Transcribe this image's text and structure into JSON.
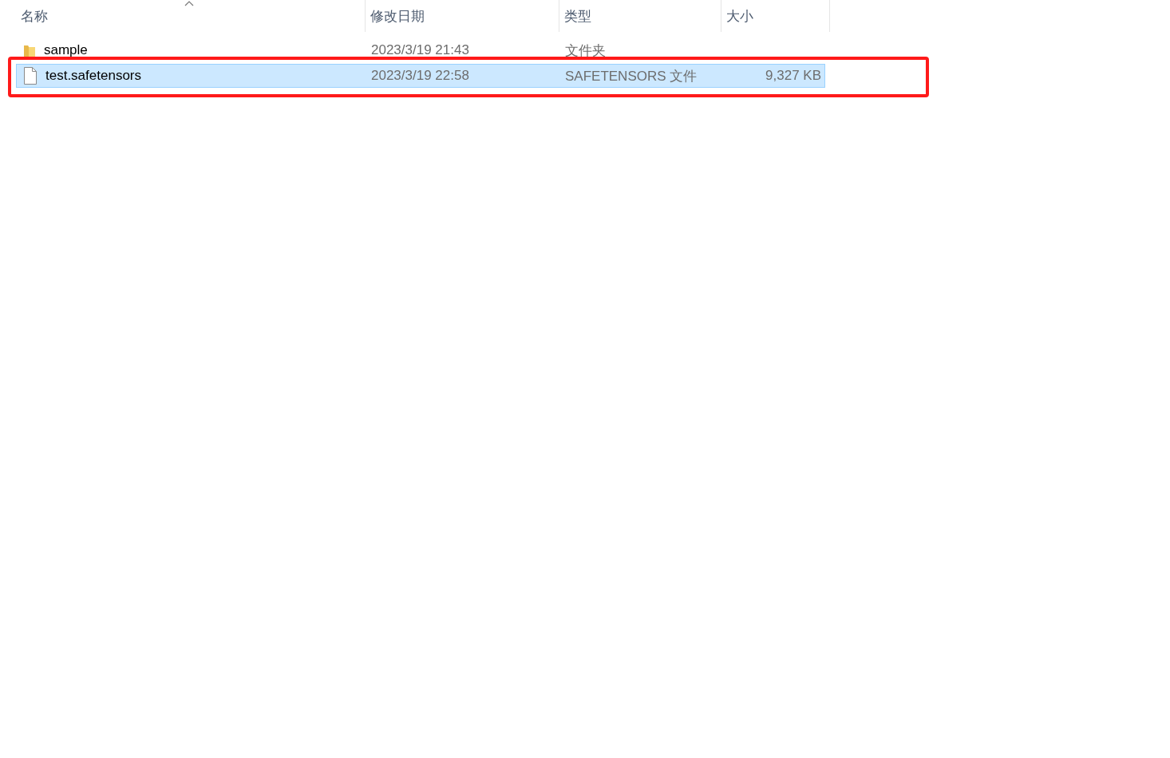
{
  "columns": [
    {
      "label": "名称",
      "sorted": true
    },
    {
      "label": "修改日期",
      "sorted": false
    },
    {
      "label": "类型",
      "sorted": false
    },
    {
      "label": "大小",
      "sorted": false
    }
  ],
  "rows": [
    {
      "kind": "folder",
      "name": "sample",
      "modified": "2023/3/19 21:43",
      "type": "文件夹",
      "selected": false,
      "annotated": false
    },
    {
      "kind": "file",
      "name": "test.safetensors",
      "modified": "2023/3/19 22:58",
      "type": "SAFETENSORS 文件",
      "size": "9,327 KB",
      "selected": true,
      "annotated": true
    }
  ]
}
